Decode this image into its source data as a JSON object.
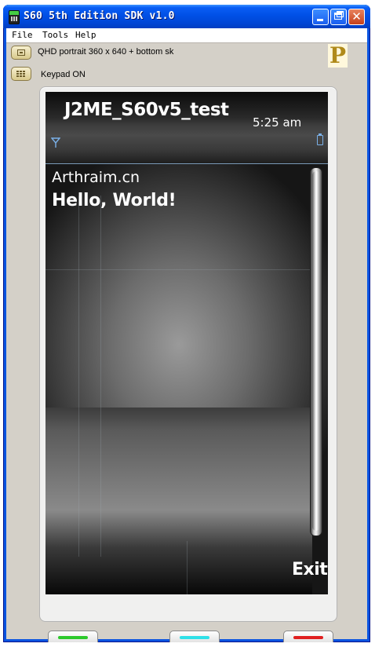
{
  "window": {
    "title": "S60 5th Edition SDK v1.0"
  },
  "menubar": {
    "items": [
      "File",
      "Tools",
      "Help"
    ]
  },
  "toolbar": {
    "skin_label": "QHD portrait 360 x 640 + bottom sk",
    "keypad_label": "Keypad ON",
    "logo_letter": "P"
  },
  "device": {
    "app_title": "J2ME_S60v5_test",
    "time": "5:25 am",
    "lines": [
      "Arthraim.cn",
      "Hello, World!"
    ],
    "softkey_right": "Exit",
    "softkey_colors": {
      "left": "#2cc92c",
      "center": "#2ee0e8",
      "right": "#e02020"
    }
  },
  "colors": {
    "titlebar": "#0050e6",
    "client_bg": "#d4d0c8",
    "screen_bg": "#000000"
  }
}
